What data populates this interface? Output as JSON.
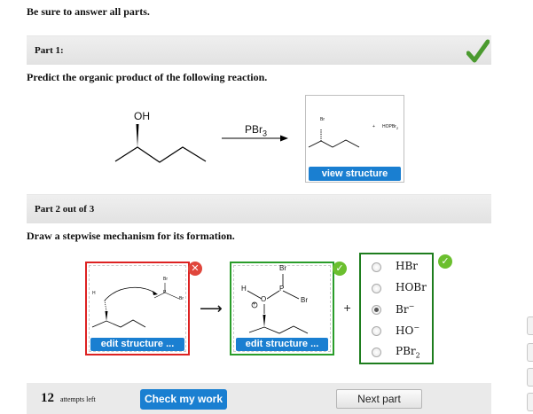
{
  "instruction": "Be sure to answer all parts.",
  "part1": {
    "title": "Part 1:",
    "prompt": "Predict the organic product of the following reaction.",
    "reactant_label": "OH",
    "reagent_label": "PBr",
    "reagent_sub": "3",
    "product_br_label": "Br",
    "product_byproduct_plus": "+",
    "product_byproduct": "HOPBr",
    "product_byproduct_sub": "2",
    "view_button": "view structure",
    "status": "correct",
    "colors": {
      "check": "#4a9a2e",
      "button": "#1a7fd1"
    }
  },
  "part2": {
    "title": "Part 2 out of 3",
    "prompt": "Draw a stepwise mechanism for its formation.",
    "box1": {
      "labels": {
        "h": "H",
        "br_top": "Br",
        "p": "P",
        "br_right": "Br"
      },
      "edit_button": "edit structure ...",
      "status": "incorrect",
      "status_color": "#e0463c"
    },
    "arrow": "⟶",
    "box2": {
      "labels": {
        "br_top": "Br",
        "h": "H",
        "p": "P",
        "br_right": "Br",
        "o": "O",
        "charge": "+"
      },
      "edit_button": "edit structure ...",
      "status": "correct",
      "status_color": "#6bbf2e"
    },
    "plus": "+",
    "options": [
      {
        "label": "HBr",
        "sup": "",
        "sub": "",
        "selected": false
      },
      {
        "label": "HOBr",
        "sup": "",
        "sub": "",
        "selected": false
      },
      {
        "label": "Br",
        "sup": "−",
        "sub": "",
        "selected": true
      },
      {
        "label": "HO",
        "sup": "−",
        "sub": "",
        "selected": false
      },
      {
        "label": "PBr",
        "sup": "",
        "sub": "2",
        "selected": false
      }
    ],
    "options_status": "correct"
  },
  "footer": {
    "attempts_count": "12",
    "attempts_text": "attempts left",
    "check_button": "Check my work",
    "next_button": "Next part"
  },
  "side_tabs": 4
}
